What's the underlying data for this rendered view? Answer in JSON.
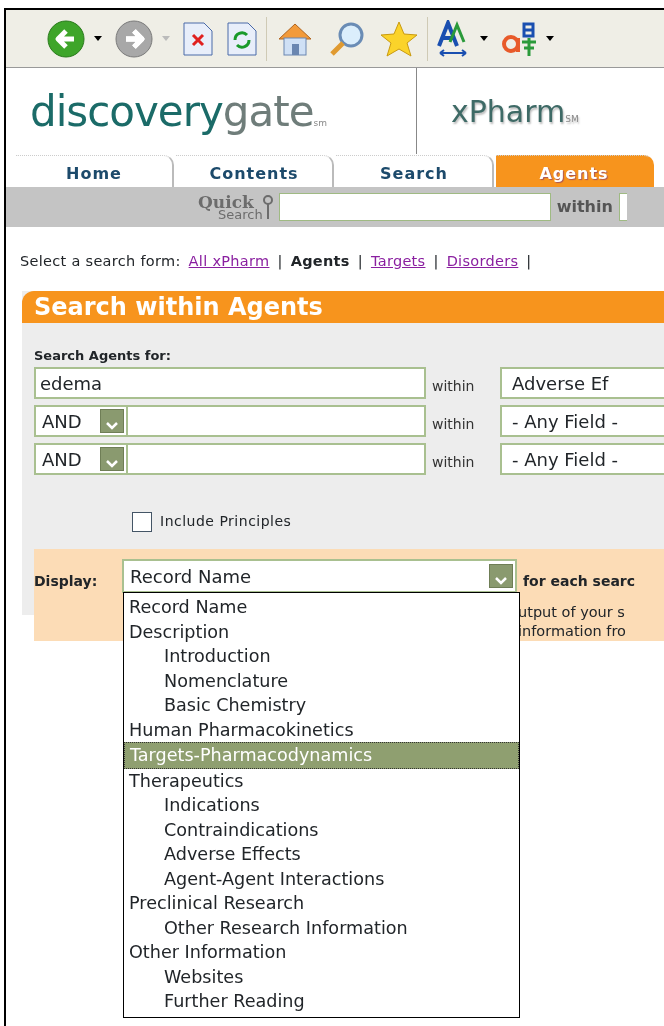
{
  "toolbar": {
    "buttons": [
      {
        "kind": "back",
        "menu": true,
        "disabled": false
      },
      {
        "kind": "forward",
        "menu": true,
        "disabled": true
      },
      {
        "kind": "stop",
        "menu": false,
        "disabled": false
      },
      {
        "kind": "refresh",
        "menu": false,
        "disabled": false
      },
      {
        "kind": "sep"
      },
      {
        "kind": "home",
        "menu": false,
        "disabled": false
      },
      {
        "kind": "search",
        "menu": false,
        "disabled": false
      },
      {
        "kind": "favorites",
        "menu": false,
        "disabled": false
      },
      {
        "kind": "sep"
      },
      {
        "kind": "font",
        "menu": true,
        "disabled": false
      },
      {
        "kind": "encoding",
        "menu": true,
        "disabled": false
      }
    ]
  },
  "header": {
    "logo": {
      "parts": [
        {
          "text": "discovery",
          "kind": "primary"
        },
        {
          "text": "gate",
          "kind": "secondary"
        }
      ],
      "mark": "sm"
    },
    "product": {
      "text": "xPharm",
      "mark": "SM"
    }
  },
  "tabs": [
    {
      "label": "Home",
      "selected": false
    },
    {
      "label": "Contents",
      "selected": false
    },
    {
      "label": "Search",
      "selected": false
    },
    {
      "label": "Agents",
      "selected": true
    }
  ],
  "quick_search": {
    "logo_top": "Quick",
    "logo_bottom": "Search",
    "within": "within"
  },
  "form_links": {
    "prompt": "Select a search form:",
    "separators": [
      "|",
      "|",
      "|",
      "|"
    ],
    "links": [
      {
        "label": "All xPharm",
        "selected": false
      },
      {
        "label": "Agents",
        "selected": true
      },
      {
        "label": "Targets",
        "selected": false
      },
      {
        "label": "Disorders",
        "selected": false
      }
    ]
  },
  "panel": {
    "title": "Search within Agents",
    "label": "Search Agents for:",
    "rows": [
      {
        "kind": "plain",
        "value": "edema",
        "within": "within",
        "field": "Adverse Ef"
      },
      {
        "kind": "operator",
        "operator": "AND",
        "value": "",
        "within": "within",
        "field": "- Any Field -"
      },
      {
        "kind": "operator",
        "operator": "AND",
        "value": "",
        "within": "within",
        "field": "- Any Field -"
      }
    ],
    "include": {
      "label": "Include Principles",
      "checked": false
    },
    "display": {
      "label": "Display:",
      "value": "Record Name",
      "suffix": "for each searc",
      "note_lines": [
        "utput of your s",
        "information fro"
      ],
      "expanded": true,
      "options": [
        {
          "label": "Record Name",
          "highlighted": false
        },
        {
          "label": "Description",
          "highlighted": false,
          "children": [
            {
              "label": "Introduction",
              "highlighted": false
            },
            {
              "label": "Nomenclature",
              "highlighted": false
            },
            {
              "label": "Basic Chemistry",
              "highlighted": false
            }
          ]
        },
        {
          "label": "Human Pharmacokinetics",
          "highlighted": false
        },
        {
          "label": "Targets-Pharmacodynamics",
          "highlighted": true
        },
        {
          "label": "Therapeutics",
          "highlighted": false,
          "children": [
            {
              "label": "Indications",
              "highlighted": false
            },
            {
              "label": "Contraindications",
              "highlighted": false
            },
            {
              "label": "Adverse Effects",
              "highlighted": false
            },
            {
              "label": "Agent-Agent Interactions",
              "highlighted": false
            }
          ]
        },
        {
          "label": "Preclinical Research",
          "highlighted": false,
          "children": [
            {
              "label": "Other Research Information",
              "highlighted": false
            }
          ]
        },
        {
          "label": "Other Information",
          "highlighted": false,
          "children": [
            {
              "label": "Websites",
              "highlighted": false
            },
            {
              "label": "Further Reading",
              "highlighted": false
            }
          ]
        }
      ]
    }
  }
}
